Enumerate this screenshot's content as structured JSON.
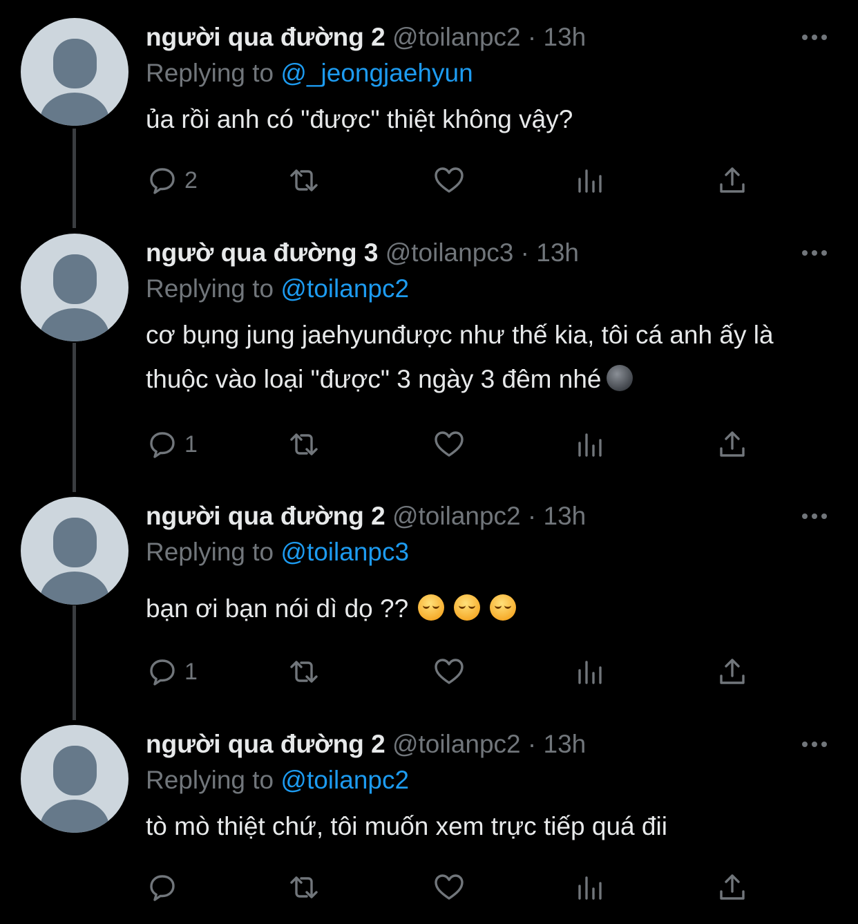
{
  "tweets": [
    {
      "name": "người qua đường 2",
      "handle": "@toilanpc2",
      "separator": " · ",
      "time": "13h",
      "replying_prefix": "Replying to ",
      "replying_to": "@_jeongjaehyun",
      "text": "ủa rồi anh có \"được\" thiệt không vậy?",
      "replies": "2",
      "emojis": []
    },
    {
      "name": "ngườ qua đường 3",
      "handle": "@toilanpc3",
      "separator": " · ",
      "time": "13h",
      "replying_prefix": "Replying to ",
      "replying_to": "@toilanpc2",
      "text": "cơ bụng jung jaehyunđược như thế kia, tôi cá anh ấy là thuộc vào loại \"được\" 3 ngày 3 đêm nhé",
      "replies": "1",
      "emojis": [
        "new-moon-face"
      ]
    },
    {
      "name": "người qua đường 2",
      "handle": "@toilanpc2",
      "separator": " · ",
      "time": "13h",
      "replying_prefix": "Replying to ",
      "replying_to": "@toilanpc3",
      "text": "bạn ơi bạn nói dì dọ ??",
      "replies": "1",
      "emojis": [
        "disappointed-face",
        "disappointed-face",
        "disappointed-face"
      ]
    },
    {
      "name": "người qua đường 2",
      "handle": "@toilanpc2",
      "separator": " · ",
      "time": "13h",
      "replying_prefix": "Replying to ",
      "replying_to": "@toilanpc2",
      "text": "tò mò thiệt chứ, tôi muốn xem trực tiếp quá đii",
      "replies": "",
      "emojis": []
    }
  ],
  "colors": {
    "background": "#000000",
    "text": "#e7e9ea",
    "muted": "#71767b",
    "link": "#1d9bf0",
    "thread_line": "#3a3d40",
    "avatar_bg": "#cdd6dd",
    "avatar_fg": "#66798a"
  },
  "icons": [
    "more-icon",
    "reply-icon",
    "retweet-icon",
    "like-icon",
    "views-icon",
    "share-icon"
  ]
}
